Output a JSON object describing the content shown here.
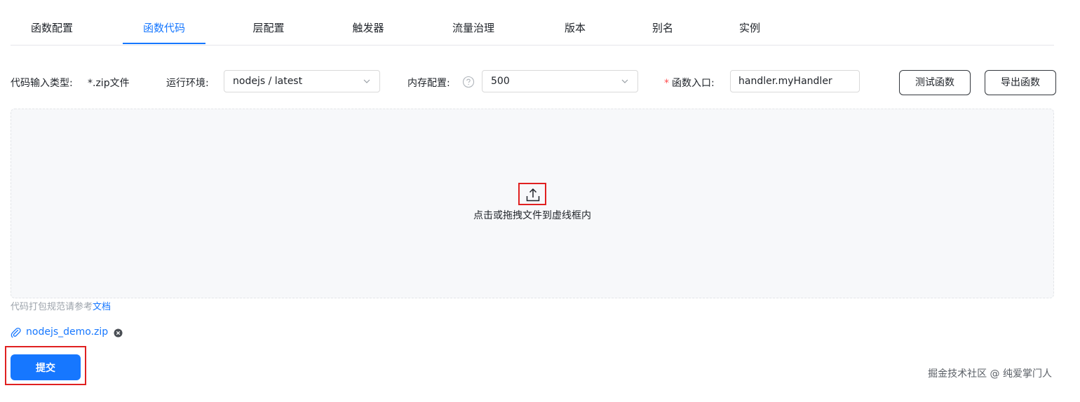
{
  "tabs": [
    {
      "label": "函数配置",
      "active": false
    },
    {
      "label": "函数代码",
      "active": true
    },
    {
      "label": "层配置",
      "active": false
    },
    {
      "label": "触发器",
      "active": false
    },
    {
      "label": "流量治理",
      "active": false
    },
    {
      "label": "版本",
      "active": false
    },
    {
      "label": "别名",
      "active": false
    },
    {
      "label": "实例",
      "active": false
    }
  ],
  "config": {
    "code_type_label": "代码输入类型:",
    "code_type_value": "*.zip文件",
    "runtime_label": "运行环境:",
    "runtime_value": "nodejs / latest",
    "memory_label": "内存配置:",
    "memory_value": "500",
    "entry_required_mark": "*",
    "entry_label": "函数入口:",
    "entry_value": "handler.myHandler",
    "test_button": "测试函数",
    "export_button": "导出函数"
  },
  "upload": {
    "prompt": "点击或拖拽文件到虚线框内",
    "hint_text": "代码打包规范请参考",
    "hint_link": "文档"
  },
  "file": {
    "name": "nodejs_demo.zip"
  },
  "submit_label": "提交",
  "watermark": "掘金技术社区 @ 纯爱掌门人",
  "colors": {
    "accent": "#1677ff",
    "highlight": "#e02020"
  },
  "icons": [
    "help-icon",
    "chevron-down-icon",
    "upload-icon",
    "paperclip-icon",
    "close-circle-icon"
  ]
}
